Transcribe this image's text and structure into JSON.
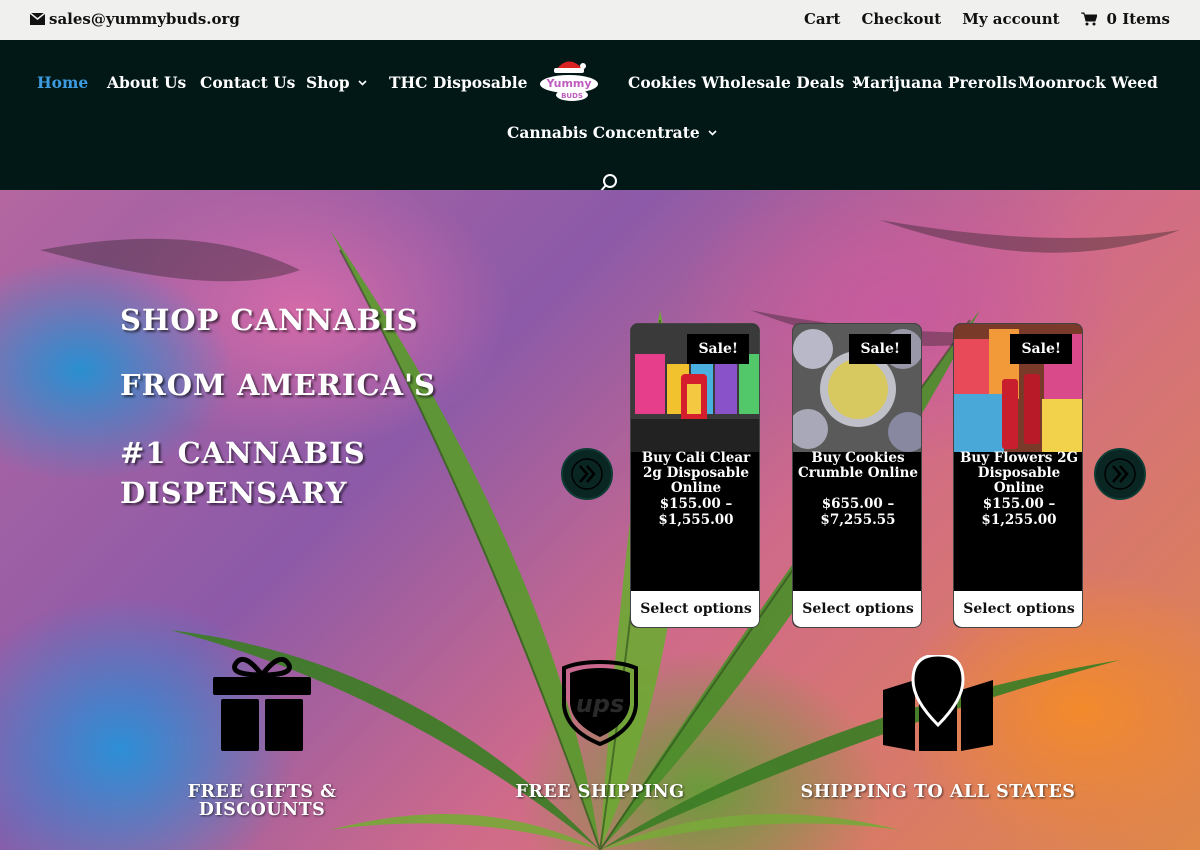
{
  "topbar": {
    "email": "sales@yummybuds.org",
    "links": [
      "Cart",
      "Checkout",
      "My account"
    ],
    "cart_count": "0 Items"
  },
  "nav": {
    "items": [
      {
        "label": "Home",
        "active": true
      },
      {
        "label": "About Us"
      },
      {
        "label": "Contact Us"
      },
      {
        "label": "Shop",
        "dropdown": true
      },
      {
        "label": "THC Disposable"
      },
      {
        "label": "Cookies Wholesale Deals",
        "dropdown": true
      },
      {
        "label": "Marijuana Prerolls"
      },
      {
        "label": "Moonrock Weed"
      },
      {
        "label": "Cannabis Concentrate",
        "dropdown": true
      }
    ]
  },
  "hero": {
    "headline": [
      "SHOP CANNABIS",
      "FROM AMERICA'S",
      "#1 CANNABIS",
      "DISPENSARY"
    ]
  },
  "products": [
    {
      "badge": "Sale!",
      "title": "Buy Cali Clear 2g Disposable Online",
      "price": "$155.00 – $1,555.00",
      "button": "Select options"
    },
    {
      "badge": "Sale!",
      "title": "Buy Cookies Crumble Online",
      "price": "$655.00 – $7,255.55",
      "button": "Select options"
    },
    {
      "badge": "Sale!",
      "title": "Buy Flowers 2G Disposable Online",
      "price": "$155.00 – $1,255.00",
      "button": "Select options"
    }
  ],
  "features": [
    {
      "label": "FREE GIFTS & DISCOUNTS",
      "icon": "gift-icon"
    },
    {
      "label": "FREE SHIPPING",
      "icon": "ups-icon"
    },
    {
      "label": "SHIPPING TO ALL STATES",
      "icon": "map-pin-icon"
    }
  ],
  "colors": {
    "nav_bg": "#021817",
    "nav_active": "#3d9be0",
    "topbar_bg": "#f0f0ee"
  }
}
